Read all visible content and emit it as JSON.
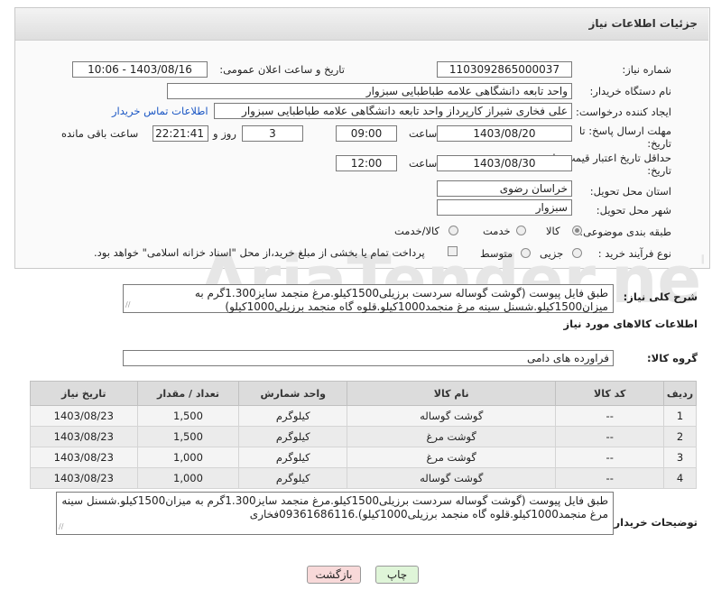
{
  "header": {
    "title": "جزئیات اطلاعات نیاز"
  },
  "fields": {
    "need_number_label": "شماره نیاز:",
    "need_number": "1103092865000037",
    "announce_label": "تاریخ و ساعت اعلان عمومی:",
    "announce_value": "1403/08/16 - 10:06",
    "buyer_org_label": "نام دستگاه خریدار:",
    "buyer_org": "واحد تابعه دانشگاهی علامه طباطبایی سبزوار",
    "requester_label": "ایجاد کننده درخواست:",
    "requester": "علی فخاری شیراز کارپرداز واحد تابعه دانشگاهی علامه طباطبایی سبزوار",
    "contact_link": "اطلاعات تماس خریدار",
    "deadline_label_1": "مهلت ارسال پاسخ: تا",
    "deadline_label_2": "تاریخ:",
    "deadline_date": "1403/08/20",
    "time_label": "ساعت",
    "deadline_time": "09:00",
    "days_value": "3",
    "days_label": "روز و",
    "remaining_time": "22:21:41",
    "remaining_label": "ساعت باقی مانده",
    "validity_label_1": "حداقل تاریخ اعتبار قیمت: تا",
    "validity_label_2": "تاریخ:",
    "validity_date": "1403/08/30",
    "validity_time": "12:00",
    "province_label": "استان محل تحویل:",
    "province": "خراسان رضوی",
    "city_label": "شهر محل تحویل:",
    "city": "سبزوار",
    "category_label": "طبقه بندی موضوعی:",
    "category_options": [
      "کالا",
      "خدمت",
      "کالا/خدمت"
    ],
    "purchase_type_label": "نوع فرآیند خرید :",
    "purchase_options": [
      "جزیی",
      "متوسط"
    ],
    "payment_note": "پرداخت تمام یا بخشی از مبلغ خرید،از محل \"اسناد خزانه اسلامی\" خواهد بود.",
    "summary_label": "شرح کلی نیاز:",
    "summary": "طبق فایل پیوست (گوشت گوساله سردست برزیلی1500کیلو.مرغ منجمد سایز1.300گرم به میزان1500کیلو.شسنل سینه مرغ منجمد1000کیلو.قلوه گاه منجمد برزیلی1000کیلو)",
    "goods_info_title": "اطلاعات کالاهای مورد نیاز",
    "goods_group_label": "گروه کالا:",
    "goods_group": "فراورده های دامی",
    "buyer_notes_label": "توضیحات خریدار:",
    "buyer_notes": "طبق فایل پیوست (گوشت گوساله سردست برزیلی1500کیلو.مرغ منجمد سایز1.300گرم به میزان1500کیلو.شسنل سینه مرغ منجمد1000کیلو.قلوه گاه منجمد برزیلی1000کیلو).09361686116فخاری"
  },
  "table": {
    "headers": [
      "ردیف",
      "کد کالا",
      "نام کالا",
      "واحد شمارش",
      "تعداد / مقدار",
      "تاریخ نیاز"
    ],
    "rows": [
      [
        "1",
        "--",
        "گوشت گوساله",
        "کیلوگرم",
        "1,500",
        "1403/08/23"
      ],
      [
        "2",
        "--",
        "گوشت مرغ",
        "کیلوگرم",
        "1,500",
        "1403/08/23"
      ],
      [
        "3",
        "--",
        "گوشت مرغ",
        "کیلوگرم",
        "1,000",
        "1403/08/23"
      ],
      [
        "4",
        "--",
        "گوشت گوساله",
        "کیلوگرم",
        "1,000",
        "1403/08/23"
      ]
    ]
  },
  "buttons": {
    "print": "چاپ",
    "back": "بازگشت"
  },
  "watermark": "AriaTender.neT",
  "colors": {
    "link": "#1a56c4",
    "print_button_bg": "#dff5d8",
    "back_button_bg": "#f8d9d9"
  }
}
